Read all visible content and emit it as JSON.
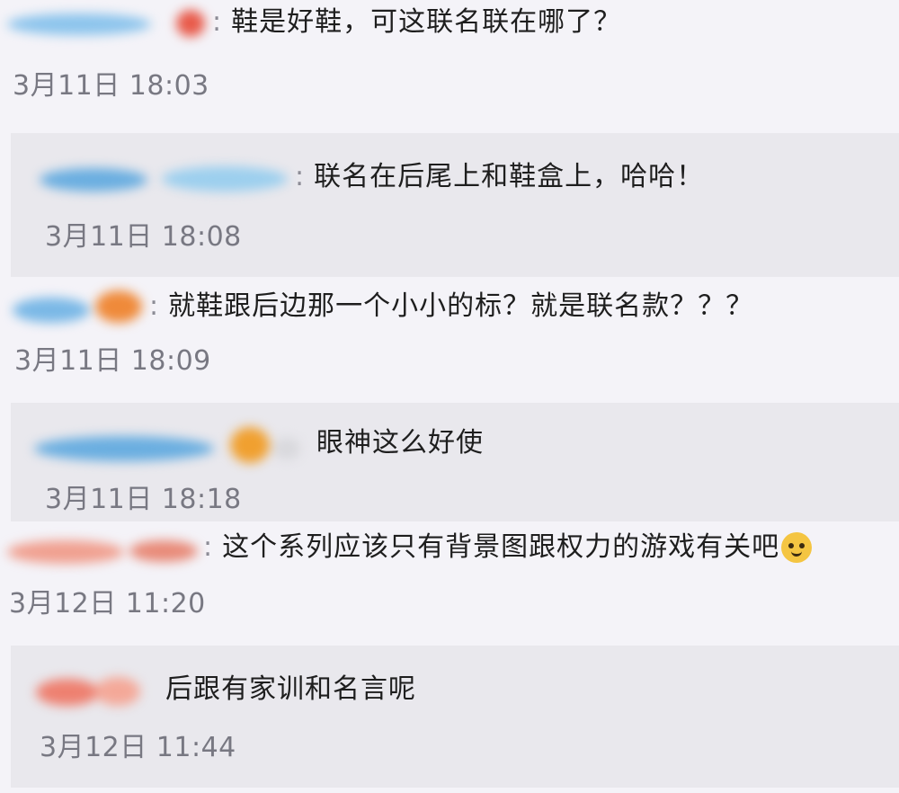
{
  "comments": [
    {
      "kind": "top",
      "username": "",
      "text": "鞋是好鞋，可这联名联在哪了？",
      "time": "3月11日 18:03",
      "avatar_colors": [
        "#8cc4ec",
        "#e85a4a"
      ]
    },
    {
      "kind": "reply",
      "username": "",
      "text": "联名在后尾上和鞋盒上，哈哈！",
      "time": "3月11日 18:08",
      "avatar_colors": [
        "#6aaee0",
        "#9ccfee"
      ]
    },
    {
      "kind": "top",
      "username": "",
      "text": "就鞋跟后边那一个小小的标？就是联名款？？？",
      "time": "3月11日 18:09",
      "avatar_colors": [
        "#7ab8e6",
        "#ef8a3a"
      ]
    },
    {
      "kind": "reply",
      "username": "",
      "text": "眼神这么好使",
      "time": "3月11日 18:18",
      "avatar_colors": [
        "#6aaee0",
        "#f0a030"
      ]
    },
    {
      "kind": "top",
      "username": "",
      "text": "这个系列应该只有背景图跟权力的游戏有关吧",
      "time": "3月12日 11:20",
      "avatar_colors": [
        "#f0a090",
        "#e88a78"
      ],
      "emoji": "smirk-face-icon"
    },
    {
      "kind": "reply",
      "username": "",
      "text": "后跟有家训和名言呢",
      "time": "3月12日 11:44",
      "avatar_colors": [
        "#ee8070",
        "#f4a898"
      ]
    }
  ],
  "colon": ":"
}
